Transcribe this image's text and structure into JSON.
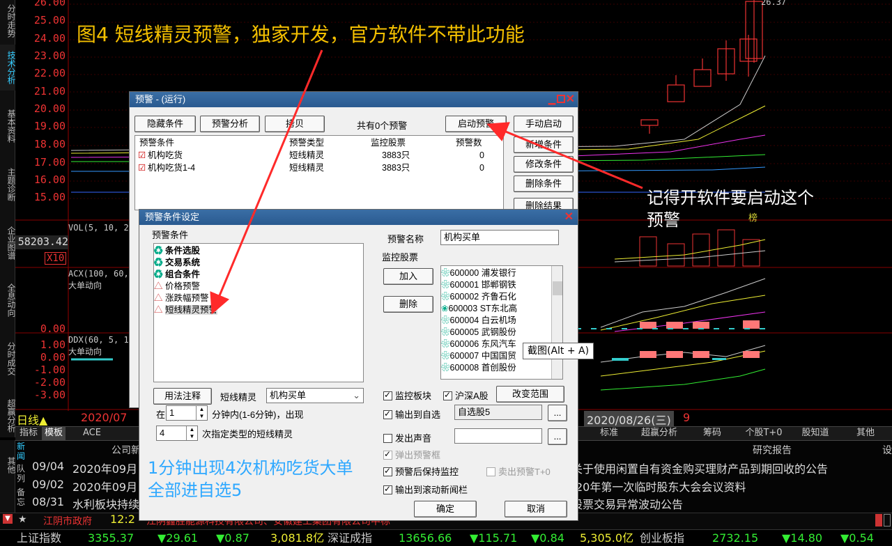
{
  "annotation": {
    "title": "图4 短线精灵预警，独家开发，官方软件不带此功能",
    "reminder_line1": "记得开软件要启动这个",
    "reminder_line2": "预警",
    "bottom_line1": "1分钟出现4次机构吃货大单",
    "bottom_line2": "全部进自选5",
    "tooltip": "截图(Alt + A)"
  },
  "left_tabs": [
    "分时走势",
    "技术分析",
    "基本资料",
    "主题诊断",
    "企业图谱",
    "全息动向",
    "分时成交",
    "超赢分析",
    "其他"
  ],
  "chart": {
    "y_ticks": [
      "26.00",
      "25.00",
      "24.00",
      "23.00",
      "22.00",
      "21.00",
      "20.00",
      "19.00",
      "18.00",
      "17.00",
      "16.00",
      "15.00"
    ],
    "high_label": "26.37",
    "vol_label": "VOL(5, 10, 20",
    "vol_value": "58203.42",
    "vol_unit": "X10",
    "acx_label": "ACX(100, 60,",
    "acx_sub": "大单动向",
    "acx_zero": "0.00",
    "ddx_label": "DDX(60, 5, 10",
    "ddx_sub": "大单动向",
    "ddx_ticks": [
      "1.00",
      "0.00",
      "-1.00",
      "-2.00",
      "-3.00"
    ],
    "rank_tag": "榜",
    "period": "日线▲",
    "date_left": "2020/07",
    "date_right": "2020/08/26(三)",
    "date_right_extra": "9"
  },
  "tabbar": {
    "left_items": [
      "指标",
      "模板",
      "ACE"
    ],
    "right_items": [
      "标准",
      "超赢分析",
      "筹码",
      "个股T+0",
      "股知道",
      "其他"
    ]
  },
  "news": {
    "side_tabs": [
      "新闻",
      "队列",
      "备忘"
    ],
    "left_header": "公司新",
    "right_header": "研究报告",
    "right_header_short": "设",
    "rows": [
      {
        "date": "09/04",
        "left": "2020年09月",
        "right": "关于使用闲置自有资金购买理财产品到期回收的公告"
      },
      {
        "date": "09/02",
        "left": "2020年09月",
        "right": "20年第一次临时股东大会会议资料"
      },
      {
        "date": "08/31",
        "left": "水利板块持续",
        "right": "股票交易异常波动公告"
      }
    ]
  },
  "statusbar": {
    "star": "★",
    "place": "江阴市政府",
    "time": "12:2",
    "ticker": "江阴鑫胜能源科技有限公司、安徽建工集团有限公司中标"
  },
  "indices": [
    {
      "name": "上证指数",
      "value": "3355.37",
      "change": "▼29.61",
      "pct": "▼0.87",
      "amount": "3,081.8亿"
    },
    {
      "name": "深证成指",
      "value": "13656.66",
      "change": "▼115.71",
      "pct": "▼0.84",
      "amount": "5,305.0亿"
    },
    {
      "name": "创业板指",
      "value": "2732.15",
      "change": "▼14.80",
      "pct": "▼0.54",
      "amount": ""
    }
  ],
  "alert_dialog": {
    "title": "预警 - (运行)",
    "btn_hide": "隐藏条件",
    "btn_analyze": "预警分析",
    "btn_copy": "拷贝",
    "count_text": "共有0个预警",
    "btn_start": "启动预警",
    "btn_manual": "手动启动",
    "btn_new": "新增条件",
    "btn_modify": "修改条件",
    "btn_delete": "删除条件",
    "btn_clear": "删除结果",
    "headers": [
      "预警条件",
      "预警类型",
      "监控股票",
      "预警数"
    ],
    "rows": [
      {
        "name": "机构吃货",
        "type": "短线精灵",
        "stocks": "3883只",
        "count": "0"
      },
      {
        "name": "机构吃货1-4",
        "type": "短线精灵",
        "stocks": "3883只",
        "count": "0"
      }
    ]
  },
  "cond_dialog": {
    "title": "预警条件设定",
    "group_label": "预警条件",
    "tree": [
      {
        "icon": "♻",
        "label": "条件选股",
        "bold": true
      },
      {
        "icon": "♻",
        "label": "交易系统",
        "bold": true
      },
      {
        "icon": "♻",
        "label": "组合条件",
        "bold": true
      },
      {
        "icon": "△",
        "label": "价格预警",
        "bold": false
      },
      {
        "icon": "△",
        "label": "涨跌幅预警",
        "bold": false
      },
      {
        "icon": "△",
        "label": "短线精灵预警",
        "bold": false
      }
    ],
    "btn_usage": "用法注释",
    "type_label": "短线精灵",
    "type_select": "机构买单",
    "in_label": "在",
    "minutes_value": "1",
    "minutes_text": "分钟内(1-6分钟)，出现",
    "times_value": "4",
    "times_text": "次指定类型的短线精灵",
    "name_label": "预警名称",
    "name_value": "机构买单",
    "monitor_label": "监控股票",
    "btn_add": "加入",
    "btn_remove": "删除",
    "stocks": [
      {
        "code": "600000",
        "name": "浦发银行"
      },
      {
        "code": "600001",
        "name": "邯郸钢铁"
      },
      {
        "code": "600002",
        "name": "齐鲁石化"
      },
      {
        "code": "600003",
        "name": "ST东北高"
      },
      {
        "code": "600004",
        "name": "白云机场"
      },
      {
        "code": "600005",
        "name": "武钢股份"
      },
      {
        "code": "600006",
        "name": "东风汽车"
      },
      {
        "code": "600007",
        "name": "中国国贸"
      },
      {
        "code": "600008",
        "name": "首创股份"
      }
    ],
    "chk_board": "监控板块",
    "chk_hs": "沪深A股",
    "btn_range": "改变范围",
    "chk_output": "输出到自选",
    "output_value": "自选股5",
    "chk_sound": "发出声音",
    "chk_popup": "弹出预警框",
    "chk_keep": "预警后保持监控",
    "chk_sell": "卖出预警T+0",
    "chk_scroll": "输出到滚动新闻栏",
    "btn_ok": "确定",
    "btn_cancel": "取消",
    "dots": "..."
  }
}
